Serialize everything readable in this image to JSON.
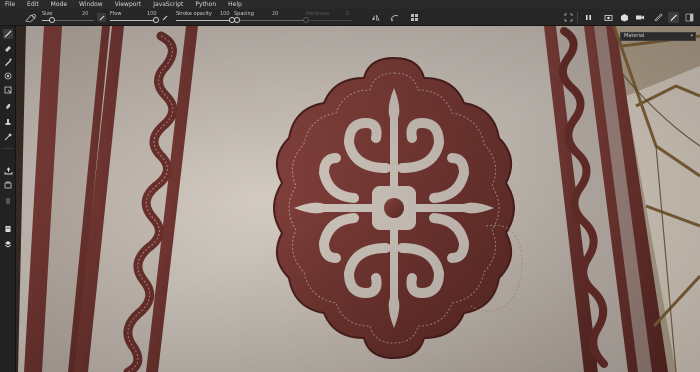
{
  "menu": [
    "File",
    "Edit",
    "Mode",
    "Window",
    "Viewport",
    "JavaScript",
    "Python",
    "Help"
  ],
  "toolbar": {
    "size": {
      "label": "Size",
      "value": "20",
      "fraction": 0.2
    },
    "flow": {
      "label": "Flow",
      "value": "100",
      "fraction": 1.0
    },
    "stroke_opacity": {
      "label": "Stroke opacity",
      "value": "100",
      "fraction": 1.0
    },
    "spacing": {
      "label": "Spacing",
      "value": "20",
      "fraction": 0.04
    },
    "hardness": {
      "label": "Hardness",
      "value": "0",
      "fraction": 0.0
    }
  },
  "material": {
    "selected": "Material"
  },
  "colors": {
    "fabric": "#cdc4bb",
    "felt": "#7a3a36",
    "felt_dark": "#5a2622",
    "panel": "#262626",
    "menu": "#2a2a2a"
  },
  "icons": {
    "top_right": [
      "symmetry-icon",
      "grid-icon",
      "play-icon",
      "camera-icon",
      "cube-icon",
      "ruler-icon",
      "paint-brush-icon"
    ],
    "left": [
      "brush-icon",
      "eraser-icon",
      "projection-icon",
      "geometry-fill-icon",
      "polygon-fill-icon",
      "smudge-icon",
      "clone-icon",
      "picker-icon",
      "bake-icon",
      "layers-icon",
      "export-icon",
      "shelf-icon",
      "display-icon",
      "texture-set-icon"
    ]
  }
}
